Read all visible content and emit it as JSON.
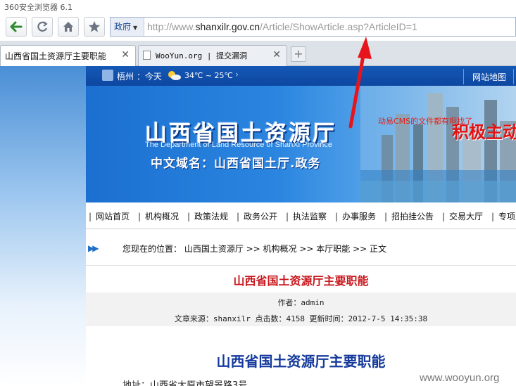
{
  "browser": {
    "title": "360安全浏览器 6.1",
    "address": {
      "category": "政府",
      "url_prefix": "http://www.",
      "url_domain": "shanxilr.gov.cn",
      "url_path": "/Article/ShowArticle.asp?ArticleID=1"
    },
    "tabs": [
      {
        "label": "山西省国土资源厅主要职能",
        "close": "✕"
      },
      {
        "label": "WooYun.org | 提交漏洞",
        "close": "✕"
      }
    ],
    "new_tab": "+"
  },
  "weather": {
    "city": "梧州 ：今天",
    "temperature": "34℃ ~ 25℃",
    "more": "›",
    "sitemap": "网站地图"
  },
  "banner": {
    "title": "山西省国土资源厅",
    "subtitle_en": "The Department of Land Resource of ShanXi Province",
    "domain": "中文域名：山西省国土厅.政务",
    "note": "动易CMS的文件都有啊找了",
    "slogan": "积极主动"
  },
  "nav": {
    "items": [
      "网站首页",
      "机构概况",
      "政策法规",
      "政务公开",
      "执法监察",
      "办事服务",
      "招拍挂公告",
      "交易大厅",
      "专项"
    ]
  },
  "breadcrumb": {
    "text": "您现在的位置： 山西国土资源厅 >> 机构概况 >> 本厅职能 >> 正文"
  },
  "article": {
    "title": "山西省国土资源厅主要职能",
    "author": "作者：admin",
    "meta": "文章来源：shanxilr 点击数：4158 更新时间：2012-7-5 14:35:38",
    "body_title": "山西省国土资源厅主要职能",
    "address_line": "地址：山西省太原市望景路3号"
  },
  "watermark": "www.wooyun.org",
  "colors": {
    "arrow": "#e8141b",
    "banner_blue": "#1b6fd0",
    "title_red": "#c8171d",
    "body_title_blue": "#153a9c"
  }
}
